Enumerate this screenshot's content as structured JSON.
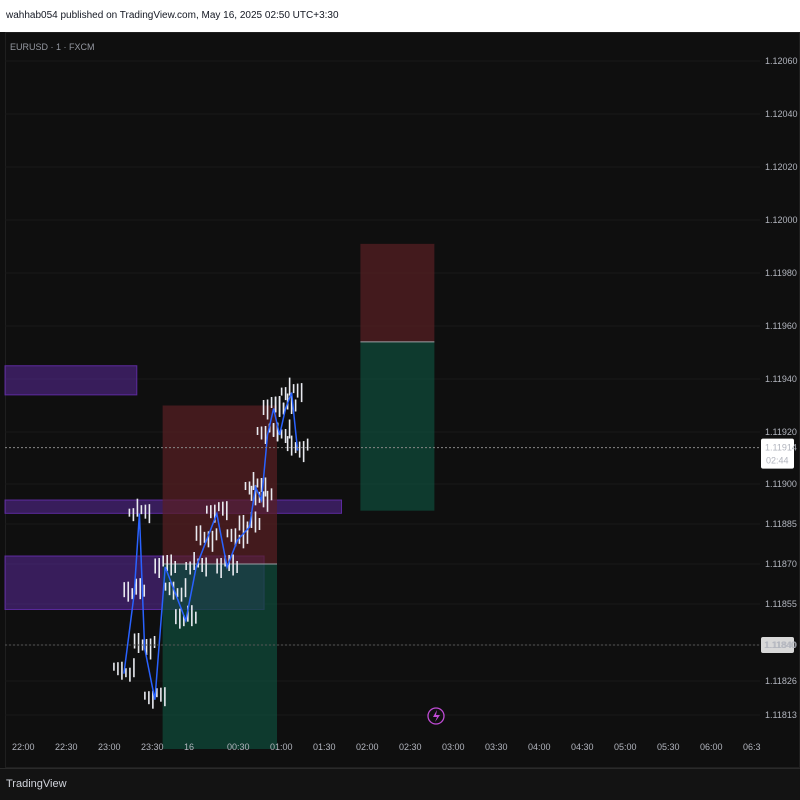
{
  "header": {
    "published_text": "wahhab054 published on TradingView.com, May 16, 2025 02:50 UTC+3:30"
  },
  "symbol_label": "EURUSD · 1 · FXCM",
  "footer": {
    "brand": "TradingView"
  },
  "colors": {
    "background": "#0f0f0f",
    "candle": "#e8eaf0",
    "ma_line": "#2962ff",
    "zone": "#6a2fb8",
    "stop_zone": "#5a1f24",
    "target_zone": "#0f4a3a",
    "price_tag": "#e8e8e8"
  },
  "chart_data": {
    "type": "line",
    "instrument": "EURUSD · 1 · FXCM",
    "y_ticks": [
      "1.12060",
      "1.12040",
      "1.12020",
      "1.12000",
      "1.11980",
      "1.11960",
      "1.11940",
      "1.11920",
      "1.11900",
      "1.11885",
      "1.11870",
      "1.11855",
      "1.11840",
      "1.11826",
      "1.11813"
    ],
    "x_ticks": [
      "22:00",
      "22:30",
      "23:00",
      "23:30",
      "16",
      "00:30",
      "01:00",
      "01:30",
      "02:00",
      "02:30",
      "03:00",
      "03:30",
      "04:00",
      "04:30",
      "05:00",
      "05:30",
      "06:00",
      "06:3"
    ],
    "current_price": {
      "value": 1.11914,
      "label": "1.11914",
      "countdown": "02:44"
    },
    "marked_price": {
      "value": 1.1184,
      "label": "1.11840"
    },
    "series": [
      {
        "values": [
          [
            0.0,
            1.1183
          ],
          [
            0.1,
            1.1186
          ],
          [
            0.15,
            1.1189
          ],
          [
            0.2,
            1.1184
          ],
          [
            0.3,
            1.1182
          ],
          [
            0.4,
            1.1187
          ],
          [
            0.5,
            1.1186
          ],
          [
            0.6,
            1.1185
          ],
          [
            0.7,
            1.1187
          ],
          [
            0.8,
            1.1188
          ],
          [
            0.9,
            1.1189
          ],
          [
            1.0,
            1.1187
          ],
          [
            1.1,
            1.1188
          ],
          [
            1.2,
            1.11885
          ],
          [
            1.25,
            1.119
          ],
          [
            1.3,
            1.11895
          ],
          [
            1.35,
            1.1192
          ],
          [
            1.4,
            1.1193
          ],
          [
            1.45,
            1.1192
          ],
          [
            1.5,
            1.1193
          ],
          [
            1.55,
            1.11936
          ],
          [
            1.6,
            1.11914
          ]
        ]
      }
    ],
    "zones": [
      {
        "kind": "supply",
        "x": [
          22.0,
          23.37
        ],
        "y": [
          1.11945,
          1.11934
        ]
      },
      {
        "kind": "supply",
        "x": [
          22.0,
          1.75
        ],
        "y": [
          1.11894,
          1.11889
        ]
      },
      {
        "kind": "supply",
        "x": [
          22.0,
          0.85
        ],
        "y": [
          1.11873,
          1.11853
        ]
      }
    ],
    "positions": [
      {
        "entry": 1.1187,
        "stop": 1.1193,
        "target": 1.118,
        "x": [
          23.67,
          1.0
        ]
      },
      {
        "entry": 1.11954,
        "stop": 1.11991,
        "target": 1.1189,
        "x": [
          1.97,
          2.83
        ]
      }
    ]
  }
}
